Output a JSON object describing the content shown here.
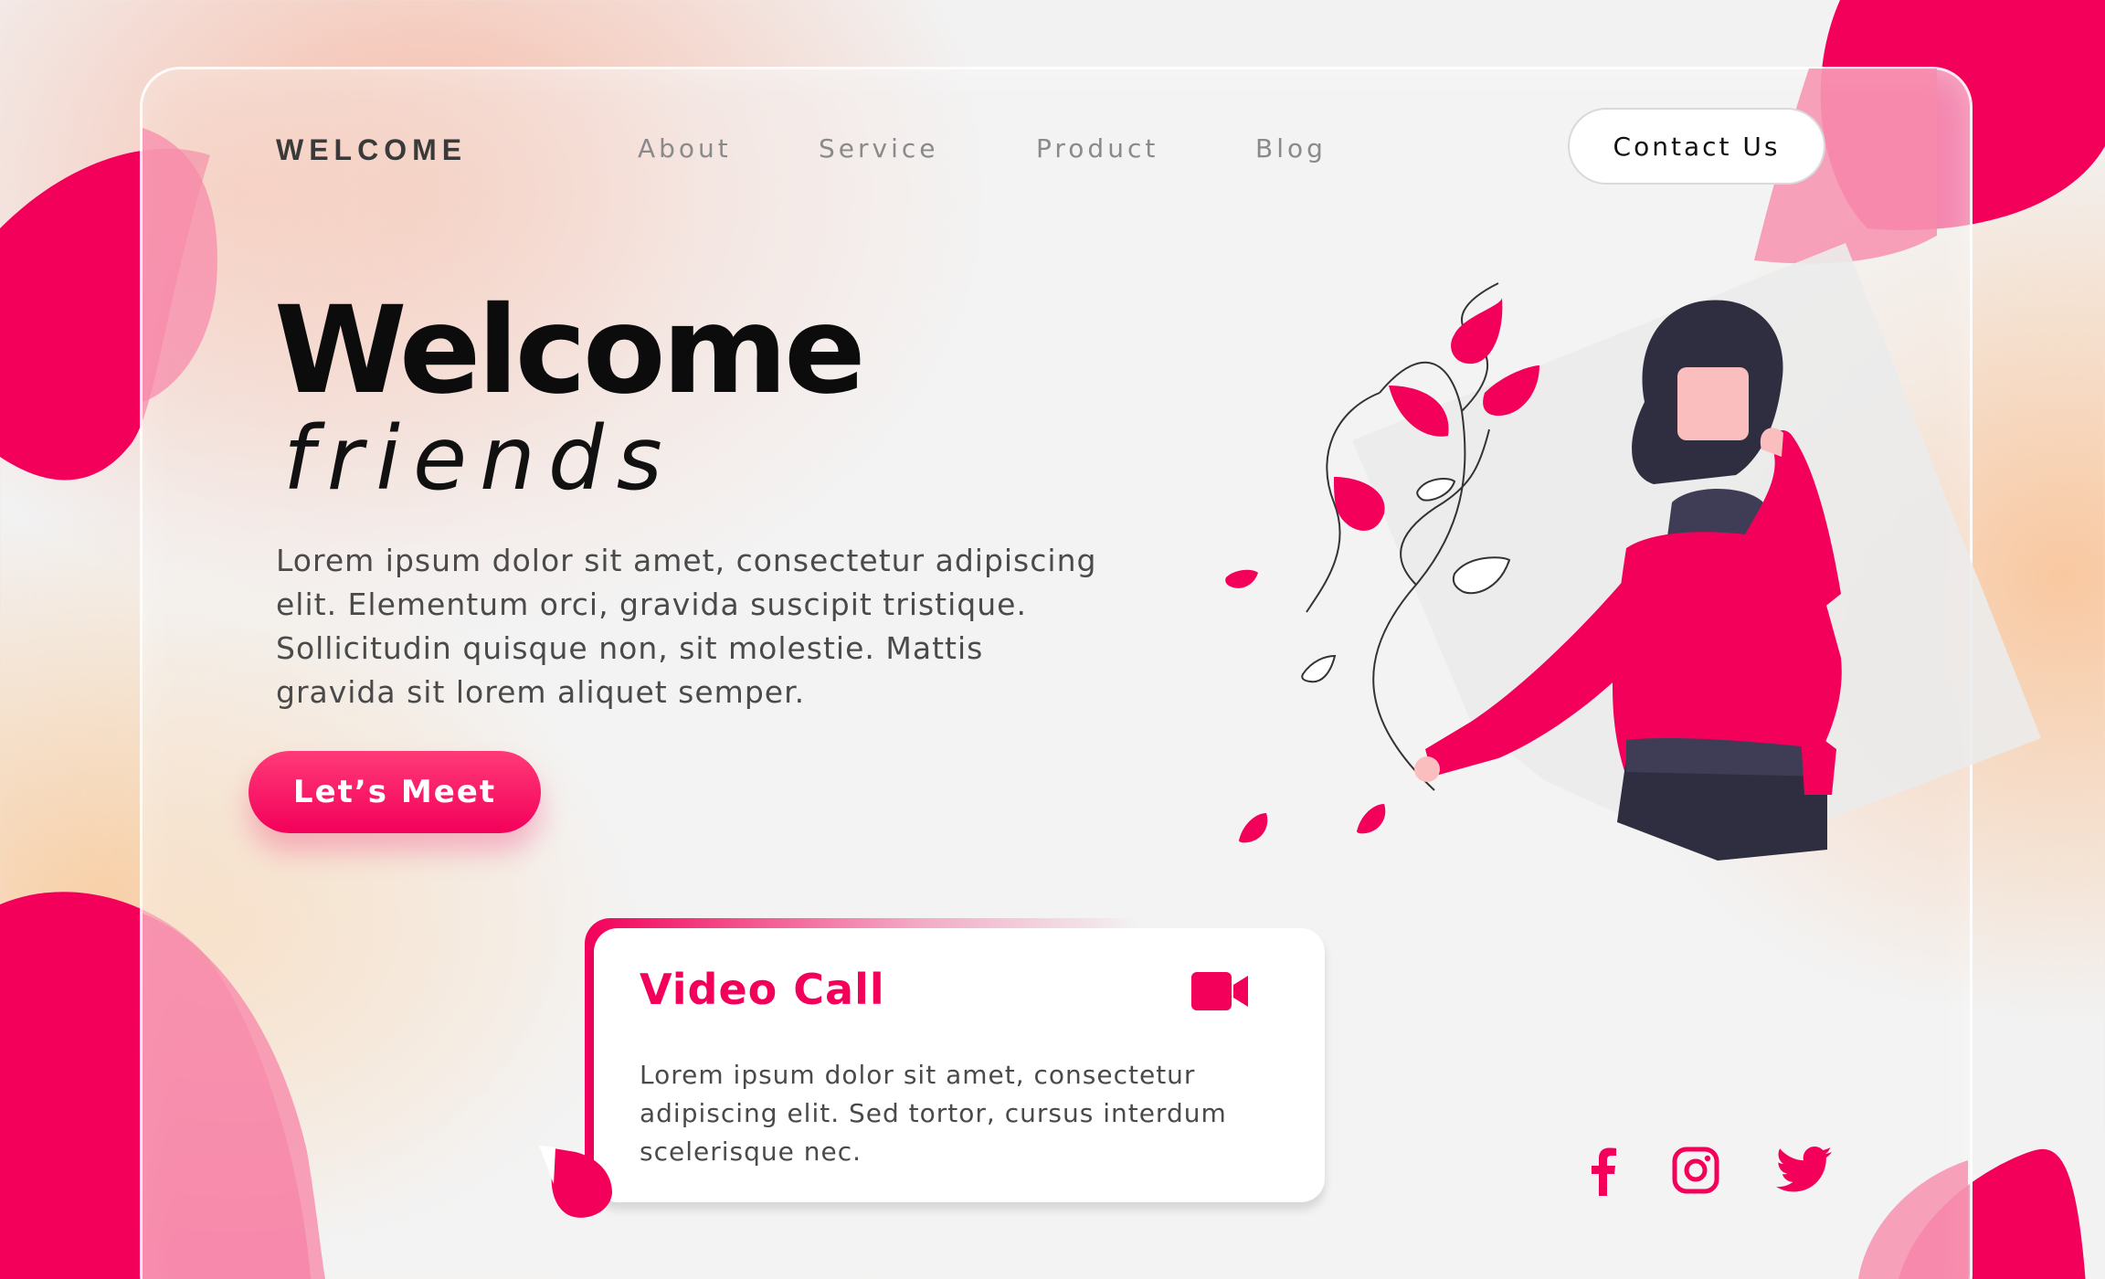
{
  "brand": {
    "logo": "WELCOME"
  },
  "nav": {
    "items": [
      {
        "label": "About"
      },
      {
        "label": "Service"
      },
      {
        "label": "Product"
      },
      {
        "label": "Blog"
      }
    ],
    "contact_label": "Contact Us"
  },
  "hero": {
    "title": "Welcome",
    "subtitle": "friends",
    "body": "Lorem ipsum dolor sit amet, consectetur adipiscing elit. Elementum orci, gravida suscipit tristique. Sollicitudin quisque non, sit molestie. Mattis gravida sit lorem aliquet semper.",
    "cta_label": "Let’s Meet"
  },
  "card": {
    "title": "Video Call",
    "icon": "video-camera-icon",
    "body": "Lorem ipsum dolor sit amet, consectetur adipiscing elit. Sed tortor, cursus interdum scelerisque nec."
  },
  "socials": {
    "icons": [
      "facebook-icon",
      "instagram-icon",
      "twitter-icon"
    ]
  },
  "colors": {
    "accent": "#f3005a",
    "accent_light": "#f78bab",
    "text_dark": "#0c0c0c",
    "text_muted": "#8a8a8a",
    "illustration_dark": "#2f2e41",
    "skin": "#fbbebe"
  }
}
